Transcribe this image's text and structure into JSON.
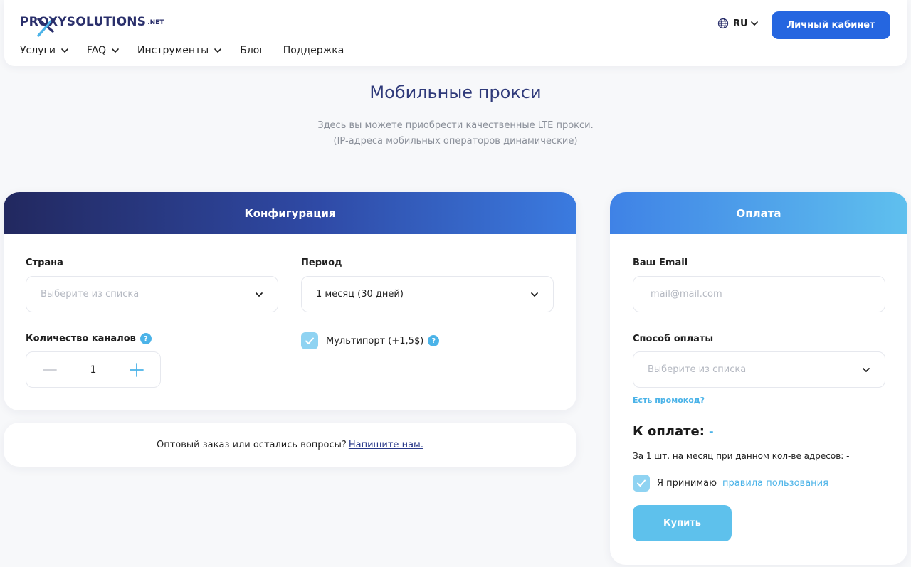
{
  "header": {
    "logo_text": "PROXYSOLUTIONS",
    "logo_suffix": ".NET",
    "nav": [
      {
        "label": "Услуги",
        "dropdown": true
      },
      {
        "label": "FAQ",
        "dropdown": true
      },
      {
        "label": "Инструменты",
        "dropdown": true
      },
      {
        "label": "Блог",
        "dropdown": false
      },
      {
        "label": "Поддержка",
        "dropdown": false
      }
    ],
    "language": "RU",
    "cabinet_button": "Личный кабинет"
  },
  "hero": {
    "title": "Мобильные прокси",
    "subtitle_line1": "Здесь вы можете приобрести качественные LTE прокси.",
    "subtitle_line2": "(IP-адреса мобильных операторов динамические)"
  },
  "config": {
    "title": "Конфигурация",
    "country_label": "Страна",
    "country_placeholder": "Выберите из списка",
    "period_label": "Период",
    "period_value": "1 месяц (30 дней)",
    "channels_label": "Количество каналов",
    "channels_value": "1",
    "multiport_label": "Мультипорт (+1,5$)",
    "multiport_checked": true
  },
  "contact": {
    "text": "Оптовый заказ или остались вопросы?",
    "link": "Напишите нам."
  },
  "payment": {
    "title": "Оплата",
    "email_label": "Ваш Email",
    "email_placeholder": "mail@mail.com",
    "method_label": "Способ оплаты",
    "method_placeholder": "Выберите из списка",
    "promo_link": "Есть промокод?",
    "total_label": "К оплате:",
    "total_value": "-",
    "per_unit": "За 1 шт. на месяц при данном кол-ве адресов: -",
    "accept_text": "Я принимаю",
    "accept_link": "правила пользования",
    "accept_checked": true,
    "buy_button": "Купить"
  },
  "colors": {
    "accent": "#2566e0",
    "light_accent": "#5ec1ec",
    "title": "#2f3a7a"
  }
}
